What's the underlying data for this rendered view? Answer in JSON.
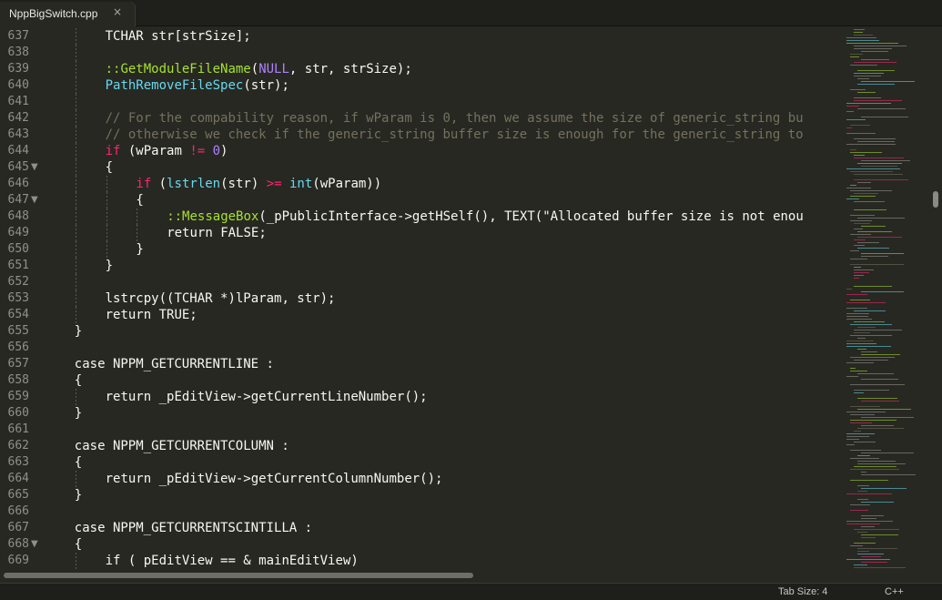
{
  "tab": {
    "title": "NppBigSwitch.cpp",
    "close_glyph": "×"
  },
  "status": {
    "tab_size": "Tab Size: 4",
    "language": "C++"
  },
  "lines": [
    {
      "num": "637",
      "fold": false,
      "indent": 4,
      "tokens": [
        {
          "t": "TCHAR str[strSize];"
        }
      ]
    },
    {
      "num": "638",
      "fold": false,
      "indent": 4,
      "tokens": []
    },
    {
      "num": "639",
      "fold": false,
      "indent": 4,
      "tokens": [
        {
          "t": "::GetModuleFileName",
          "c": "sc"
        },
        {
          "t": "("
        },
        {
          "t": "NULL",
          "c": "num"
        },
        {
          "t": ", str, strSize);"
        }
      ]
    },
    {
      "num": "640",
      "fold": false,
      "indent": 4,
      "tokens": [
        {
          "t": "PathRemoveFileSpec",
          "c": "fn"
        },
        {
          "t": "(str);"
        }
      ]
    },
    {
      "num": "641",
      "fold": false,
      "indent": 4,
      "tokens": []
    },
    {
      "num": "642",
      "fold": false,
      "indent": 4,
      "tokens": [
        {
          "t": "// For the compability reason, if wParam is 0, then we assume the size of generic_string bu",
          "c": "cm"
        }
      ]
    },
    {
      "num": "643",
      "fold": false,
      "indent": 4,
      "tokens": [
        {
          "t": "// otherwise we check if the generic_string buffer size is enough for the generic_string to",
          "c": "cm"
        }
      ]
    },
    {
      "num": "644",
      "fold": false,
      "indent": 4,
      "tokens": [
        {
          "t": "if",
          "c": "kw"
        },
        {
          "t": " (wParam "
        },
        {
          "t": "!=",
          "c": "kw"
        },
        {
          "t": " "
        },
        {
          "t": "0",
          "c": "num"
        },
        {
          "t": ")"
        }
      ]
    },
    {
      "num": "645",
      "fold": true,
      "indent": 4,
      "tokens": [
        {
          "t": "{"
        }
      ]
    },
    {
      "num": "646",
      "fold": false,
      "indent": 6,
      "tokens": [
        {
          "t": "if",
          "c": "kw"
        },
        {
          "t": " ("
        },
        {
          "t": "lstrlen",
          "c": "fn"
        },
        {
          "t": "(str) "
        },
        {
          "t": ">=",
          "c": "kw"
        },
        {
          "t": " "
        },
        {
          "t": "int",
          "c": "fn"
        },
        {
          "t": "(wParam))"
        }
      ]
    },
    {
      "num": "647",
      "fold": true,
      "indent": 6,
      "tokens": [
        {
          "t": "{"
        }
      ]
    },
    {
      "num": "648",
      "fold": false,
      "indent": 8,
      "tokens": [
        {
          "t": "::MessageBox",
          "c": "sc"
        },
        {
          "t": "(_pPublicInterface->getHSelf(), TEXT(\"Allocated buffer size is not enou"
        }
      ]
    },
    {
      "num": "649",
      "fold": false,
      "indent": 8,
      "tokens": [
        {
          "t": "return FALSE;"
        }
      ]
    },
    {
      "num": "650",
      "fold": false,
      "indent": 6,
      "tokens": [
        {
          "t": "}"
        }
      ]
    },
    {
      "num": "651",
      "fold": false,
      "indent": 4,
      "tokens": [
        {
          "t": "}"
        }
      ]
    },
    {
      "num": "652",
      "fold": false,
      "indent": 4,
      "tokens": []
    },
    {
      "num": "653",
      "fold": false,
      "indent": 4,
      "tokens": [
        {
          "t": "lstrcpy((TCHAR *)lParam, str);"
        }
      ]
    },
    {
      "num": "654",
      "fold": false,
      "indent": 4,
      "tokens": [
        {
          "t": "return TRUE;"
        }
      ]
    },
    {
      "num": "655",
      "fold": false,
      "indent": 2,
      "tokens": [
        {
          "t": "}"
        }
      ]
    },
    {
      "num": "656",
      "fold": false,
      "indent": 2,
      "tokens": []
    },
    {
      "num": "657",
      "fold": false,
      "indent": 2,
      "tokens": [
        {
          "t": "case NPPM_GETCURRENTLINE :"
        }
      ]
    },
    {
      "num": "658",
      "fold": false,
      "indent": 2,
      "tokens": [
        {
          "t": "{"
        }
      ]
    },
    {
      "num": "659",
      "fold": false,
      "indent": 4,
      "tokens": [
        {
          "t": "return _pEditView->getCurrentLineNumber();"
        }
      ]
    },
    {
      "num": "660",
      "fold": false,
      "indent": 2,
      "tokens": [
        {
          "t": "}"
        }
      ]
    },
    {
      "num": "661",
      "fold": false,
      "indent": 2,
      "tokens": []
    },
    {
      "num": "662",
      "fold": false,
      "indent": 2,
      "tokens": [
        {
          "t": "case NPPM_GETCURRENTCOLUMN :"
        }
      ]
    },
    {
      "num": "663",
      "fold": false,
      "indent": 2,
      "tokens": [
        {
          "t": "{"
        }
      ]
    },
    {
      "num": "664",
      "fold": false,
      "indent": 4,
      "tokens": [
        {
          "t": "return _pEditView->getCurrentColumnNumber();"
        }
      ]
    },
    {
      "num": "665",
      "fold": false,
      "indent": 2,
      "tokens": [
        {
          "t": "}"
        }
      ]
    },
    {
      "num": "666",
      "fold": false,
      "indent": 2,
      "tokens": []
    },
    {
      "num": "667",
      "fold": false,
      "indent": 2,
      "tokens": [
        {
          "t": "case NPPM_GETCURRENTSCINTILLA :"
        }
      ]
    },
    {
      "num": "668",
      "fold": true,
      "indent": 2,
      "tokens": [
        {
          "t": "{"
        }
      ]
    },
    {
      "num": "669",
      "fold": false,
      "indent": 4,
      "tokens": [
        {
          "t": "if ( pEditView == & mainEditView)"
        }
      ]
    }
  ]
}
